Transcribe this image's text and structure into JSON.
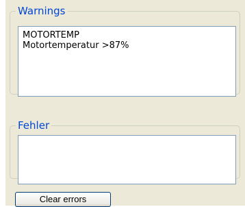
{
  "warnings": {
    "title": "Warnings",
    "items": [
      "MOTORTEMP",
      "Motortemperatur >87%"
    ]
  },
  "errors": {
    "title": "Fehler",
    "items": []
  },
  "buttons": {
    "clear_errors": "Clear errors"
  },
  "colors": {
    "panel_bg": "#ece9d8",
    "legend_text": "#0046d5",
    "group_border": "#d0d0bf",
    "list_border": "#7f9db9"
  }
}
